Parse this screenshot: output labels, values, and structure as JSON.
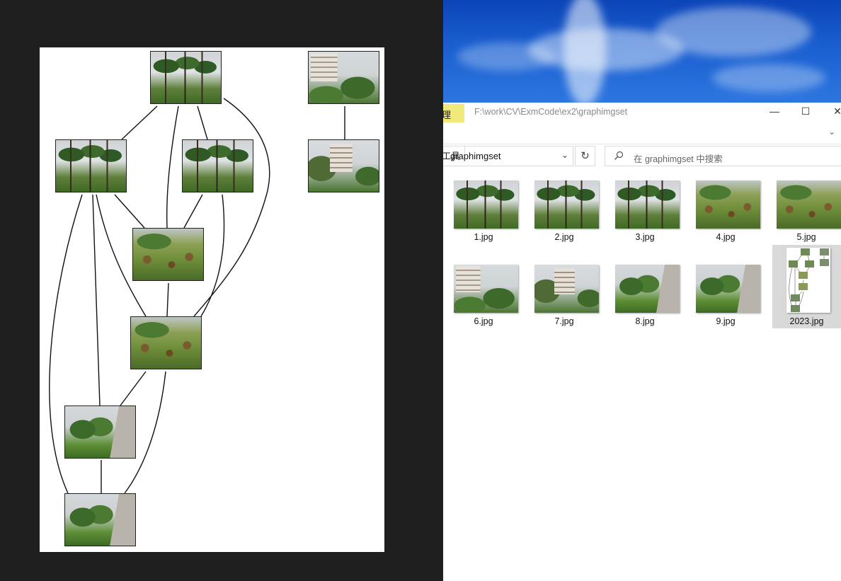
{
  "explorer": {
    "ribbon_tab_top": "理",
    "ribbon_tab_bottom": "工具",
    "title_path": "F:\\work\\CV\\ExmCode\\ex2\\graphimgset",
    "minimize_glyph": "—",
    "maximize_glyph": "☐",
    "close_glyph": "✕",
    "expand_glyph": "⌄",
    "address": "graphimgset",
    "address_dropdown_glyph": "⌄",
    "refresh_glyph": "↻",
    "search_placeholder": "在 graphimgset 中搜索",
    "files": [
      {
        "name": "1.jpg",
        "look": "palm"
      },
      {
        "name": "2.jpg",
        "look": "palm"
      },
      {
        "name": "3.jpg",
        "look": "palm"
      },
      {
        "name": "4.jpg",
        "look": "bush"
      },
      {
        "name": "5.jpg",
        "look": "bush"
      },
      {
        "name": "6.jpg",
        "look": "building"
      },
      {
        "name": "7.jpg",
        "look": "building"
      },
      {
        "name": "8.jpg",
        "look": "corridor"
      },
      {
        "name": "9.jpg",
        "look": "corridor"
      },
      {
        "name": "2023.jpg",
        "look": "graph",
        "selected": true
      }
    ]
  },
  "viewer": {
    "graph_nodes": [
      {
        "id": "n1",
        "look": "palm"
      },
      {
        "id": "n2",
        "look": "palm"
      },
      {
        "id": "n3",
        "look": "palm"
      },
      {
        "id": "n4",
        "look": "bush"
      },
      {
        "id": "n5",
        "look": "bush"
      },
      {
        "id": "n6",
        "look": "building"
      },
      {
        "id": "n7",
        "look": "building"
      },
      {
        "id": "n8",
        "look": "corridor"
      },
      {
        "id": "n9",
        "look": "corridor"
      }
    ]
  }
}
